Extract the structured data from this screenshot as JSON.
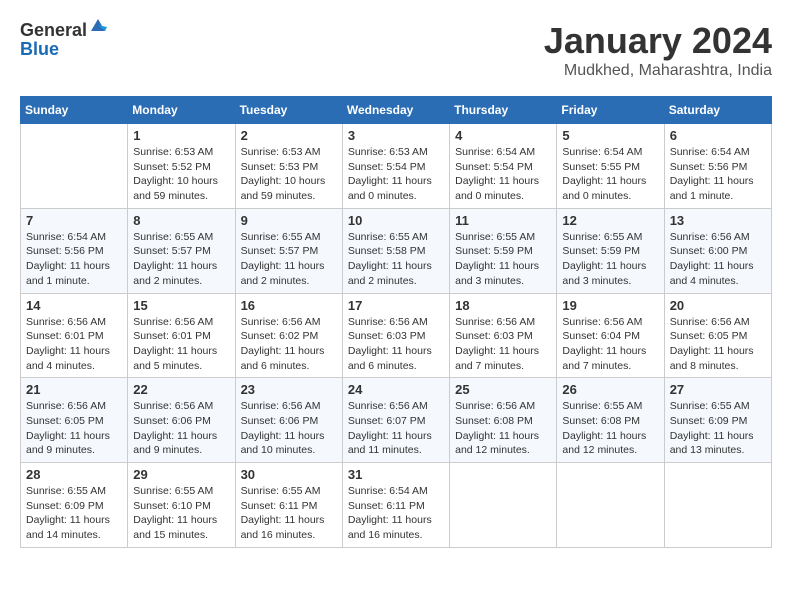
{
  "header": {
    "logo_general": "General",
    "logo_blue": "Blue",
    "title": "January 2024",
    "location": "Mudkhed, Maharashtra, India"
  },
  "calendar": {
    "days_of_week": [
      "Sunday",
      "Monday",
      "Tuesday",
      "Wednesday",
      "Thursday",
      "Friday",
      "Saturday"
    ],
    "weeks": [
      [
        {
          "day": "",
          "info": ""
        },
        {
          "day": "1",
          "info": "Sunrise: 6:53 AM\nSunset: 5:52 PM\nDaylight: 10 hours\nand 59 minutes."
        },
        {
          "day": "2",
          "info": "Sunrise: 6:53 AM\nSunset: 5:53 PM\nDaylight: 10 hours\nand 59 minutes."
        },
        {
          "day": "3",
          "info": "Sunrise: 6:53 AM\nSunset: 5:54 PM\nDaylight: 11 hours\nand 0 minutes."
        },
        {
          "day": "4",
          "info": "Sunrise: 6:54 AM\nSunset: 5:54 PM\nDaylight: 11 hours\nand 0 minutes."
        },
        {
          "day": "5",
          "info": "Sunrise: 6:54 AM\nSunset: 5:55 PM\nDaylight: 11 hours\nand 0 minutes."
        },
        {
          "day": "6",
          "info": "Sunrise: 6:54 AM\nSunset: 5:56 PM\nDaylight: 11 hours\nand 1 minute."
        }
      ],
      [
        {
          "day": "7",
          "info": "Sunrise: 6:54 AM\nSunset: 5:56 PM\nDaylight: 11 hours\nand 1 minute."
        },
        {
          "day": "8",
          "info": "Sunrise: 6:55 AM\nSunset: 5:57 PM\nDaylight: 11 hours\nand 2 minutes."
        },
        {
          "day": "9",
          "info": "Sunrise: 6:55 AM\nSunset: 5:57 PM\nDaylight: 11 hours\nand 2 minutes."
        },
        {
          "day": "10",
          "info": "Sunrise: 6:55 AM\nSunset: 5:58 PM\nDaylight: 11 hours\nand 2 minutes."
        },
        {
          "day": "11",
          "info": "Sunrise: 6:55 AM\nSunset: 5:59 PM\nDaylight: 11 hours\nand 3 minutes."
        },
        {
          "day": "12",
          "info": "Sunrise: 6:55 AM\nSunset: 5:59 PM\nDaylight: 11 hours\nand 3 minutes."
        },
        {
          "day": "13",
          "info": "Sunrise: 6:56 AM\nSunset: 6:00 PM\nDaylight: 11 hours\nand 4 minutes."
        }
      ],
      [
        {
          "day": "14",
          "info": "Sunrise: 6:56 AM\nSunset: 6:01 PM\nDaylight: 11 hours\nand 4 minutes."
        },
        {
          "day": "15",
          "info": "Sunrise: 6:56 AM\nSunset: 6:01 PM\nDaylight: 11 hours\nand 5 minutes."
        },
        {
          "day": "16",
          "info": "Sunrise: 6:56 AM\nSunset: 6:02 PM\nDaylight: 11 hours\nand 6 minutes."
        },
        {
          "day": "17",
          "info": "Sunrise: 6:56 AM\nSunset: 6:03 PM\nDaylight: 11 hours\nand 6 minutes."
        },
        {
          "day": "18",
          "info": "Sunrise: 6:56 AM\nSunset: 6:03 PM\nDaylight: 11 hours\nand 7 minutes."
        },
        {
          "day": "19",
          "info": "Sunrise: 6:56 AM\nSunset: 6:04 PM\nDaylight: 11 hours\nand 7 minutes."
        },
        {
          "day": "20",
          "info": "Sunrise: 6:56 AM\nSunset: 6:05 PM\nDaylight: 11 hours\nand 8 minutes."
        }
      ],
      [
        {
          "day": "21",
          "info": "Sunrise: 6:56 AM\nSunset: 6:05 PM\nDaylight: 11 hours\nand 9 minutes."
        },
        {
          "day": "22",
          "info": "Sunrise: 6:56 AM\nSunset: 6:06 PM\nDaylight: 11 hours\nand 9 minutes."
        },
        {
          "day": "23",
          "info": "Sunrise: 6:56 AM\nSunset: 6:06 PM\nDaylight: 11 hours\nand 10 minutes."
        },
        {
          "day": "24",
          "info": "Sunrise: 6:56 AM\nSunset: 6:07 PM\nDaylight: 11 hours\nand 11 minutes."
        },
        {
          "day": "25",
          "info": "Sunrise: 6:56 AM\nSunset: 6:08 PM\nDaylight: 11 hours\nand 12 minutes."
        },
        {
          "day": "26",
          "info": "Sunrise: 6:55 AM\nSunset: 6:08 PM\nDaylight: 11 hours\nand 12 minutes."
        },
        {
          "day": "27",
          "info": "Sunrise: 6:55 AM\nSunset: 6:09 PM\nDaylight: 11 hours\nand 13 minutes."
        }
      ],
      [
        {
          "day": "28",
          "info": "Sunrise: 6:55 AM\nSunset: 6:09 PM\nDaylight: 11 hours\nand 14 minutes."
        },
        {
          "day": "29",
          "info": "Sunrise: 6:55 AM\nSunset: 6:10 PM\nDaylight: 11 hours\nand 15 minutes."
        },
        {
          "day": "30",
          "info": "Sunrise: 6:55 AM\nSunset: 6:11 PM\nDaylight: 11 hours\nand 16 minutes."
        },
        {
          "day": "31",
          "info": "Sunrise: 6:54 AM\nSunset: 6:11 PM\nDaylight: 11 hours\nand 16 minutes."
        },
        {
          "day": "",
          "info": ""
        },
        {
          "day": "",
          "info": ""
        },
        {
          "day": "",
          "info": ""
        }
      ]
    ]
  }
}
